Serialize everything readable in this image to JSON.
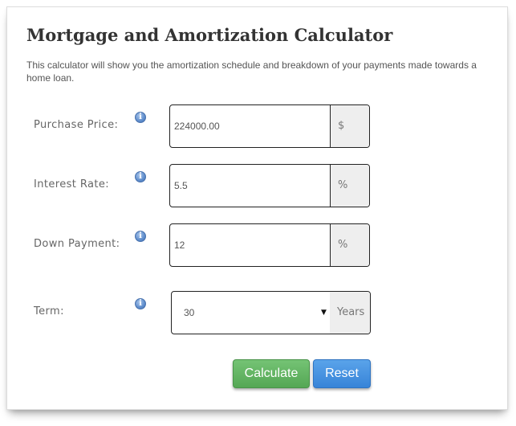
{
  "header": {
    "title": "Mortgage and Amortization Calculator",
    "description": "This calculator will show you the amortization schedule and breakdown of your payments made towards a home loan."
  },
  "form": {
    "purchase_price": {
      "label": "Purchase Price:",
      "value": "224000.00",
      "addon": "$"
    },
    "interest_rate": {
      "label": "Interest Rate:",
      "value": "5.5",
      "addon": "%"
    },
    "down_payment": {
      "label": "Down Payment:",
      "value": "12",
      "addon": "%"
    },
    "term": {
      "label": "Term:",
      "value": "30",
      "addon": "Years"
    }
  },
  "icons": {
    "info": "info-icon",
    "caret": "caret-down-icon"
  },
  "info_glyph": "i",
  "caret_glyph": "▼",
  "buttons": {
    "calculate": "Calculate",
    "reset": "Reset"
  },
  "colors": {
    "calculate": "#5cb85c",
    "reset": "#428bca"
  }
}
